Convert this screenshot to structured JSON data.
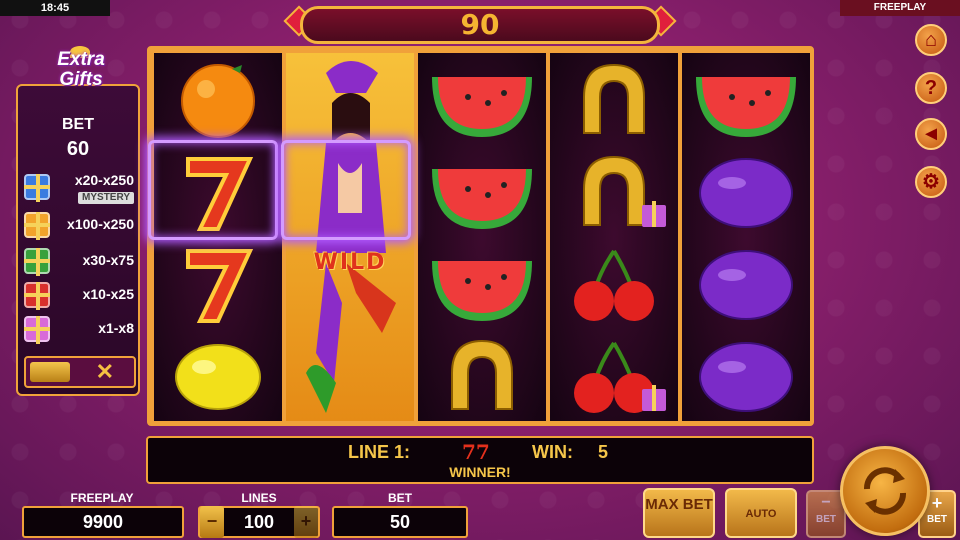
{
  "status": {
    "time": "18:45",
    "mode": "FREEPLAY"
  },
  "win_banner": {
    "value": "90"
  },
  "side_panel": {
    "logo_line1": "Extra",
    "logo_line2": "Gifts",
    "bet_label": "BET",
    "bet_value": "60",
    "payouts": [
      {
        "range": "x20-x250",
        "tag": "MYSTERY",
        "color": "#3a7be0"
      },
      {
        "range": "x100-x250",
        "color": "#f2a32b"
      },
      {
        "range": "x30-x75",
        "color": "#38a13c"
      },
      {
        "range": "x10-x25",
        "color": "#d8302c"
      },
      {
        "range": "x1-x8",
        "color": "#d86ad8"
      }
    ],
    "close_symbol": "✕"
  },
  "reels": {
    "wild_label": "WILD",
    "columns": [
      [
        "orange",
        "seven",
        "seven",
        "lemon"
      ],
      [
        "joker",
        "joker",
        "joker",
        "joker"
      ],
      [
        "watermelon",
        "watermelon",
        "watermelon",
        "horseshoe"
      ],
      [
        "horseshoe",
        "horseshoe-gift",
        "cherry",
        "cherry-gift"
      ],
      [
        "watermelon",
        "plum",
        "plum",
        "plum"
      ]
    ]
  },
  "win_line": {
    "line_label": "LINE 1:",
    "symbols": "77",
    "win_label": "WIN:",
    "win_value": "5",
    "status": "WINNER!"
  },
  "controls": {
    "freeplay_label": "FREEPLAY",
    "freeplay_value": "9900",
    "lines_label": "LINES",
    "lines_value": "100",
    "lines_minus": "−",
    "lines_plus": "+",
    "bet_label": "BET",
    "bet_value": "50",
    "max_bet_label": "MAX BET",
    "auto_label": "AUTO",
    "bet_minus_label": "BET",
    "bet_plus_label": "BET"
  },
  "side_menu": {
    "home": "⌂",
    "help": "?",
    "sound": "◄",
    "settings": "⚙"
  }
}
